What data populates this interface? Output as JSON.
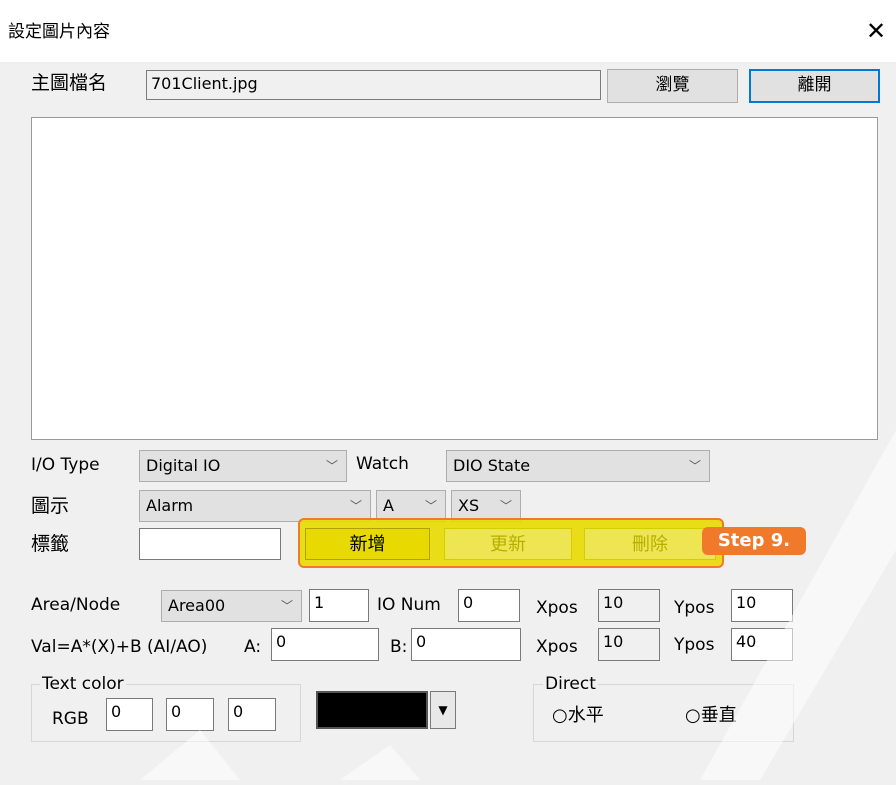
{
  "window": {
    "title": "設定圖片內容",
    "close_glyph": "✕"
  },
  "main_file": {
    "label": "主圖檔名",
    "value": "701Client.jpg",
    "browse_label": "瀏覽",
    "leave_label": "離開"
  },
  "io_type": {
    "label": "I/O Type",
    "value": "Digital IO"
  },
  "watch": {
    "label": "Watch",
    "value": "DIO State"
  },
  "icon_row": {
    "label": "圖示",
    "icon_value": "Alarm",
    "size1_value": "A",
    "size2_value": "XS"
  },
  "tag_row": {
    "label": "標籤",
    "value": ""
  },
  "actions": {
    "add_label": "新增",
    "update_label": "更新",
    "delete_label": "刪除",
    "step_label": "Step 9."
  },
  "area_node": {
    "label": "Area/Node",
    "area_value": "Area00",
    "node_value": "1",
    "io_num_label": "IO Num",
    "io_num_value": "0"
  },
  "formula": {
    "label": "Val=A*(X)+B (AI/AO)",
    "a_label": "A:",
    "a_value": "0",
    "b_label": "B:",
    "b_value": "0"
  },
  "pos1": {
    "xpos_label": "Xpos",
    "xpos_value": "10",
    "ypos_label": "Ypos",
    "ypos_value": "10"
  },
  "pos2": {
    "xpos_label": "Xpos",
    "xpos_value": "10",
    "ypos_label": "Ypos",
    "ypos_value": "40"
  },
  "text_color": {
    "label": "Text color",
    "rgb_label": "RGB",
    "r": "0",
    "g": "0",
    "b": "0",
    "swatch_color": "#000000"
  },
  "direct": {
    "label": "Direct",
    "horizontal_label": "水平",
    "vertical_label": "垂直"
  },
  "colors": {
    "highlight": "#e8da00",
    "highlight_border": "#f07a2a",
    "primary_border": "#0078d7"
  }
}
